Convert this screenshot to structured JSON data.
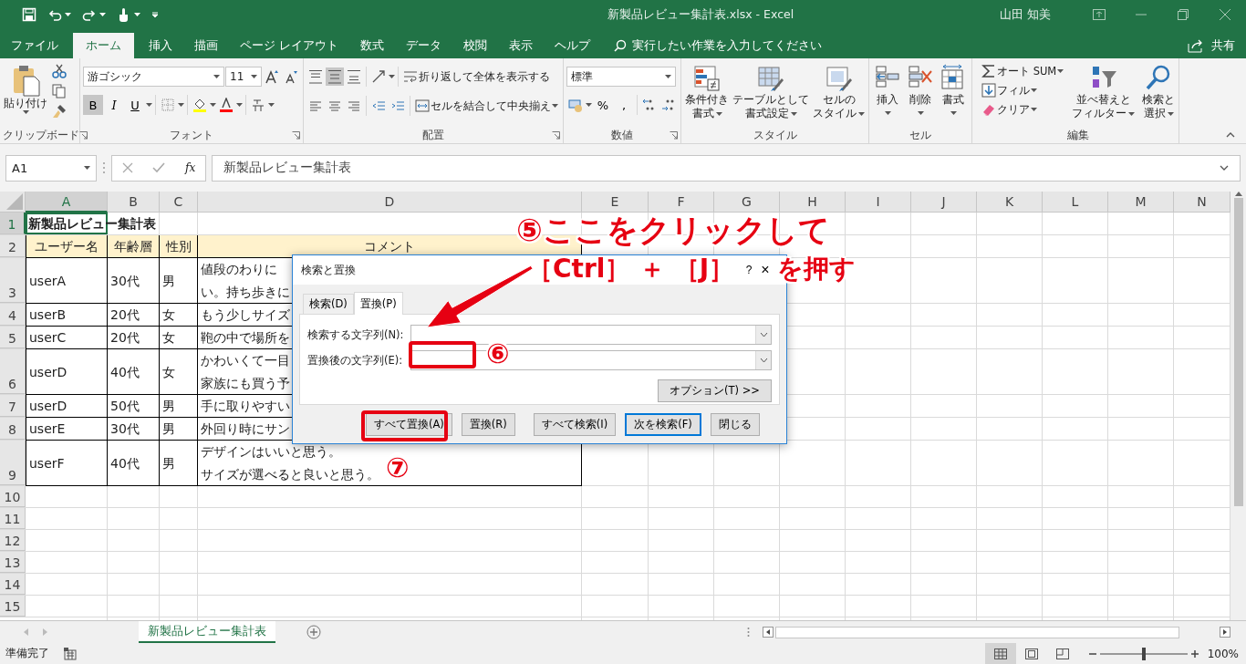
{
  "title_bar": {
    "title": "新製品レビュー集計表.xlsx  -  Excel",
    "user": "山田 知美"
  },
  "ribbon_tabs": [
    {
      "label": "ファイル",
      "selected": false
    },
    {
      "label": "ホーム",
      "selected": true
    },
    {
      "label": "挿入",
      "selected": false
    },
    {
      "label": "描画",
      "selected": false
    },
    {
      "label": "ページ レイアウト",
      "selected": false
    },
    {
      "label": "数式",
      "selected": false
    },
    {
      "label": "データ",
      "selected": false
    },
    {
      "label": "校閲",
      "selected": false
    },
    {
      "label": "表示",
      "selected": false
    },
    {
      "label": "ヘルプ",
      "selected": false
    }
  ],
  "tell_me": {
    "placeholder": "実行したい作業を入力してください"
  },
  "share": "共有",
  "ribbon": {
    "groups": [
      {
        "kind": "clipboard",
        "label": "クリップボード",
        "paste": "貼り付け"
      },
      {
        "kind": "font",
        "label": "フォント",
        "font": "游ゴシック",
        "size": "11",
        "bold_label": "B",
        "italic_label": "I",
        "underline_label": "U",
        "bold": true
      },
      {
        "kind": "alignment",
        "label": "配置",
        "middle_align": true,
        "wrap": "折り返して全体を表示する",
        "merge": "セルを結合して中央揃え"
      },
      {
        "kind": "number",
        "label": "数値",
        "format": "標準",
        "percent": "%",
        "comma": ","
      },
      {
        "kind": "large",
        "label": "スタイル",
        "buttons": [
          {
            "lines": [
              "条件付き",
              "書式"
            ]
          },
          {
            "lines": [
              "テーブルとして",
              "書式設定"
            ]
          },
          {
            "lines": [
              "セルの",
              "スタイル"
            ]
          }
        ]
      },
      {
        "kind": "large",
        "label": "セル",
        "buttons": [
          {
            "lines": [
              "挿入"
            ]
          },
          {
            "lines": [
              "削除"
            ]
          },
          {
            "lines": [
              "書式"
            ]
          }
        ]
      },
      {
        "kind": "editing",
        "label": "編集",
        "small": [
          "オート SUM",
          "フィル",
          "クリア"
        ],
        "buttons": [
          {
            "lines": [
              "並べ替えと",
              "フィルター"
            ]
          },
          {
            "lines": [
              "検索と",
              "選択"
            ]
          }
        ]
      }
    ]
  },
  "formula_bar": {
    "name_box": "A1",
    "fx": "fx",
    "formula": "新製品レビュー集計表"
  },
  "sheet": {
    "columns": [
      {
        "label": "A",
        "selected": true
      },
      {
        "label": "B",
        "selected": false
      },
      {
        "label": "C",
        "selected": false
      },
      {
        "label": "D",
        "selected": false
      },
      {
        "label": "E",
        "selected": false
      },
      {
        "label": "F",
        "selected": false
      },
      {
        "label": "G",
        "selected": false
      },
      {
        "label": "H",
        "selected": false
      },
      {
        "label": "I",
        "selected": false
      },
      {
        "label": "J",
        "selected": false
      },
      {
        "label": "K",
        "selected": false
      },
      {
        "label": "L",
        "selected": false
      },
      {
        "label": "M",
        "selected": false
      },
      {
        "label": "N",
        "selected": false
      }
    ],
    "rows": [
      {
        "number": "1",
        "kind": "title",
        "selected": true,
        "cells": [
          "新製品レビュー集計表"
        ]
      },
      {
        "number": "2",
        "kind": "header",
        "selected": false,
        "cells": [
          "ユーザー名",
          "年齢層",
          "性別",
          "コメント"
        ]
      },
      {
        "number": "3",
        "kind": "data",
        "selected": false,
        "cells": [
          "userA",
          "30代",
          "男",
          [
            "値段のわりに",
            "い。持ち歩きに"
          ]
        ]
      },
      {
        "number": "4",
        "kind": "data",
        "selected": false,
        "cells": [
          "userB",
          "20代",
          "女",
          "もう少しサイズ"
        ]
      },
      {
        "number": "5",
        "kind": "data",
        "selected": false,
        "cells": [
          "userC",
          "20代",
          "女",
          "鞄の中で場所を"
        ]
      },
      {
        "number": "6",
        "kind": "data",
        "selected": false,
        "cells": [
          "userD",
          "40代",
          "女",
          [
            "かわいくて一目",
            "家族にも買う予"
          ]
        ]
      },
      {
        "number": "7",
        "kind": "data",
        "selected": false,
        "cells": [
          "userD",
          "50代",
          "男",
          "手に取りやすい"
        ]
      },
      {
        "number": "8",
        "kind": "data",
        "selected": false,
        "cells": [
          "userE",
          "30代",
          "男",
          "外回り時にサン"
        ]
      },
      {
        "number": "9",
        "kind": "data",
        "selected": false,
        "cells": [
          "userF",
          "40代",
          "男",
          [
            "デザインはいいと思う。",
            "サイズが選べると良いと思う。"
          ]
        ]
      },
      {
        "number": "10",
        "kind": "empty",
        "selected": false
      },
      {
        "number": "11",
        "kind": "empty",
        "selected": false
      },
      {
        "number": "12",
        "kind": "empty",
        "selected": false
      },
      {
        "number": "13",
        "kind": "empty",
        "selected": false
      },
      {
        "number": "14",
        "kind": "empty",
        "selected": false
      },
      {
        "number": "15",
        "kind": "empty",
        "selected": false
      }
    ]
  },
  "sheet_tabs": [
    {
      "label": "新製品レビュー集計表",
      "selected": true
    }
  ],
  "status_bar": {
    "status": "準備完了",
    "views": [
      {
        "selected": true
      },
      {
        "selected": false
      },
      {
        "selected": false
      }
    ],
    "zoom": {
      "level": 0.5,
      "reading": "100%"
    }
  },
  "dialog": {
    "title": "検索と置換",
    "help": "?",
    "close": "×",
    "tabs": [
      {
        "label": "検索(D)",
        "selected": false
      },
      {
        "label": "置換(P)",
        "selected": true
      }
    ],
    "fields": [
      {
        "label": "検索する文字列(N):"
      },
      {
        "label": "置換後の文字列(E):"
      }
    ],
    "options": "オプション(T) >>",
    "buttons": [
      {
        "label": "すべて置換(A)",
        "default": false
      },
      {
        "label": "置換(R)",
        "default": false
      },
      {
        "label": "すべて検索(I)",
        "default": false
      },
      {
        "label": "次を検索(F)",
        "default": true
      },
      {
        "label": "閉じる",
        "default": false
      }
    ]
  },
  "annotations": {
    "lines": [
      "⑤ここをクリックして",
      "［Ctrl］ ＋ ［J］",
      "を押す"
    ],
    "markers": [
      "⑥",
      "⑦"
    ]
  }
}
